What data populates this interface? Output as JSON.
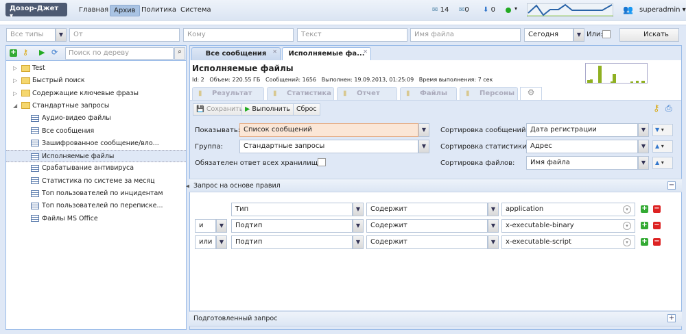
{
  "app": {
    "title": "Дозор-Джет",
    "nav": [
      "Главная",
      "Архив",
      "Политика",
      "Система"
    ],
    "active_nav": "Архив"
  },
  "status": {
    "inbox_count": "14",
    "outbox_count": "0",
    "download_count": "0",
    "status_color": "#22aa22",
    "user": "superadmin"
  },
  "filters": {
    "type": "Все типы",
    "from": "От",
    "to": "Кому",
    "text": "Текст",
    "filename": "Имя файла",
    "period": "Сегодня",
    "or_label": "Или:",
    "search": "Искать"
  },
  "tree": {
    "search_placeholder": "Поиск по дереву",
    "items": [
      {
        "label": "Test",
        "kind": "folder",
        "level": 0
      },
      {
        "label": "Быстрый поиск",
        "kind": "folder",
        "level": 0
      },
      {
        "label": "Содержащие ключевые фразы",
        "kind": "folder",
        "level": 0
      },
      {
        "label": "Стандартные запросы",
        "kind": "folder",
        "level": 0,
        "expanded": true
      },
      {
        "label": "Аудио-видео файлы",
        "kind": "query",
        "level": 1
      },
      {
        "label": "Все сообщения",
        "kind": "query",
        "level": 1
      },
      {
        "label": "Зашифрованное сообщение/вло...",
        "kind": "query",
        "level": 1
      },
      {
        "label": "Исполняемые файлы",
        "kind": "query",
        "level": 1,
        "selected": true
      },
      {
        "label": "Срабатывание антивируса",
        "kind": "query",
        "level": 1
      },
      {
        "label": "Статистика по системе за месяц",
        "kind": "query",
        "level": 1
      },
      {
        "label": "Топ пользователей по инцидентам",
        "kind": "query",
        "level": 1
      },
      {
        "label": "Топ пользователей по переписке...",
        "kind": "query",
        "level": 1
      },
      {
        "label": "Файлы MS Office",
        "kind": "query",
        "level": 1
      }
    ]
  },
  "tabs": [
    {
      "label": "Все сообщения"
    },
    {
      "label": "Исполняемые фа..."
    }
  ],
  "query": {
    "title": "Исполняемые файлы",
    "id": "Id: 2",
    "volume": "Объем: 220.55 ГБ",
    "messages": "Сообщений: 1656",
    "executed": "Выполнен: 19.09.2013, 01:25:09",
    "duration": "Время выполнения: 7 сек"
  },
  "subtabs": [
    "Результат",
    "Статистика",
    "Отчет",
    "Файлы",
    "Персоны"
  ],
  "toolbar": {
    "save": "Сохранить",
    "run": "Выполнить",
    "reset": "Сброс"
  },
  "form": {
    "show_label": "Показывать:",
    "show_value": "Список сообщений",
    "group_label": "Группа:",
    "group_value": "Стандартные запросы",
    "required_label": "Обязателен ответ всех хранилищ:",
    "sort_msg_label": "Сортировка сообщений:",
    "sort_msg_value": "Дата регистрации",
    "sort_stat_label": "Сортировка статистики:",
    "sort_stat_value": "Адрес",
    "sort_files_label": "Сортировка файлов:",
    "sort_files_value": "Имя файла"
  },
  "rules": {
    "title": "Запрос на основе правил",
    "rows": [
      {
        "op": "",
        "field": "Тип",
        "cond": "Содержит",
        "value": "application"
      },
      {
        "op": "и",
        "field": "Подтип",
        "cond": "Содержит",
        "value": "x-executable-binary"
      },
      {
        "op": "или",
        "field": "Подтип",
        "cond": "Содержит",
        "value": "x-executable-script"
      }
    ]
  },
  "prepared": {
    "title": "Подготовленный запрос"
  }
}
